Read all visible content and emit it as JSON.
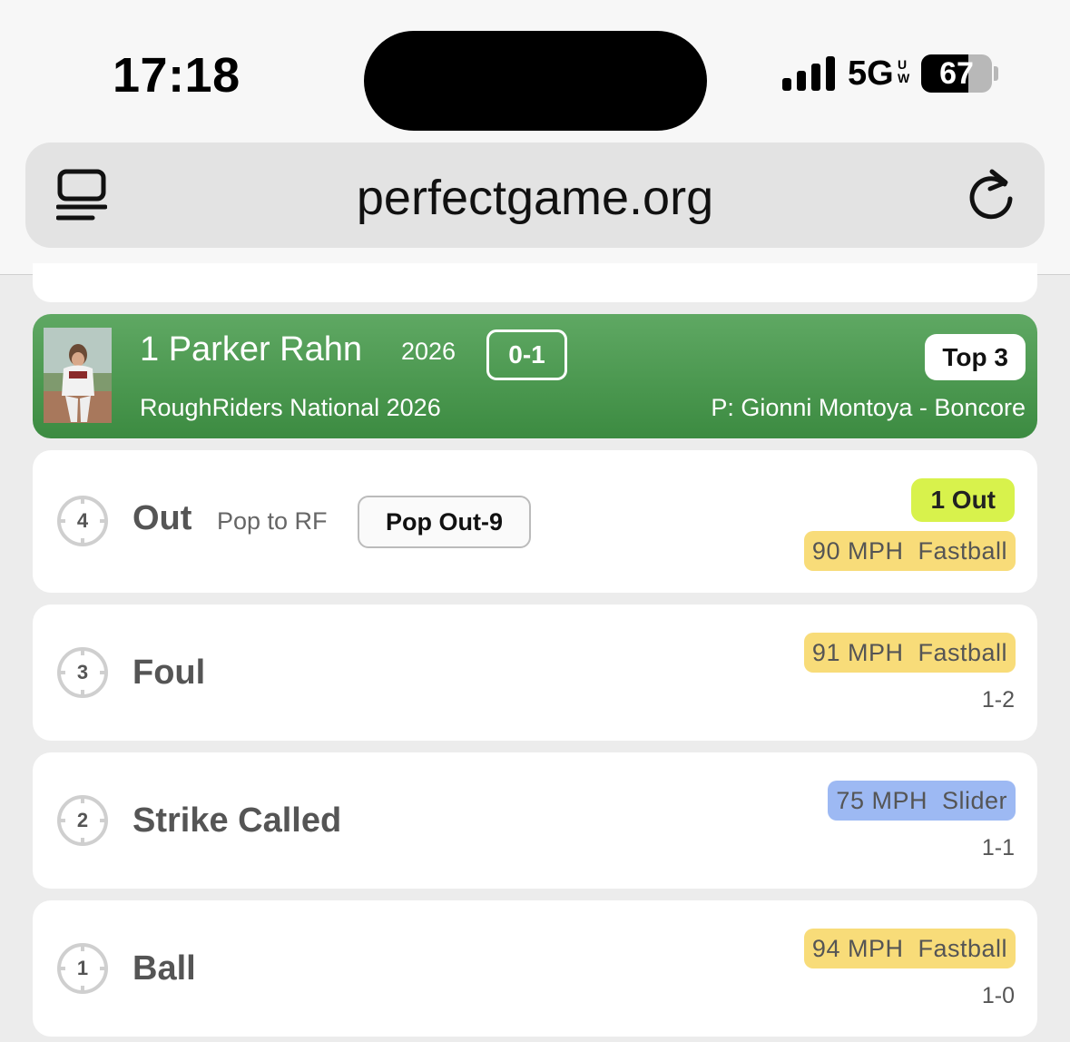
{
  "status_bar": {
    "time": "17:18",
    "network": "5G",
    "network_sub": "UW",
    "battery": "67",
    "battery_level": 0.67
  },
  "browser": {
    "url": "perfectgame.org",
    "reader_icon": "reader-mode-icon",
    "reload_icon": "reload-icon"
  },
  "at_bat": {
    "batter": "1 Parker Rahn",
    "year": "2026",
    "count": "0-1",
    "team": "RoughRiders National 2026",
    "inning": "Top 3",
    "pitcher": "P: Gionni Montoya - Boncore",
    "colors": {
      "header_top": "#5fa863",
      "header_bottom": "#3c8b41"
    }
  },
  "pitches": [
    {
      "number": "4",
      "result": "Out",
      "detail": "Pop to RF",
      "play": "Pop Out-9",
      "outs": "1 Out",
      "pitch": "90 MPH  Fastball",
      "highlight": "#f8dc79"
    },
    {
      "number": "3",
      "result": "Foul",
      "pitch": "91 MPH  Fastball",
      "count": "1-2",
      "highlight": "#f8dc79"
    },
    {
      "number": "2",
      "result": "Strike Called",
      "pitch": "75 MPH  Slider",
      "count": "1-1",
      "highlight": "#9db9f3"
    },
    {
      "number": "1",
      "result": "Ball",
      "pitch": "94 MPH  Fastball",
      "count": "1-0",
      "highlight": "#f8dc79"
    }
  ]
}
